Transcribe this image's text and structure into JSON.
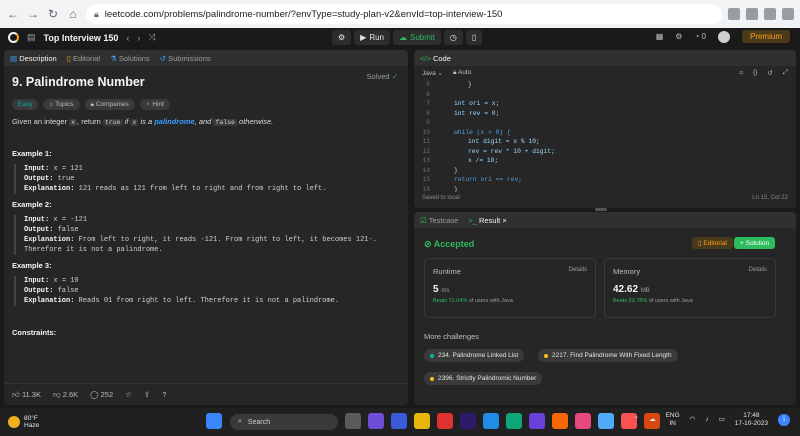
{
  "browser": {
    "url": "leetcode.com/problems/palindrome-number/?envType=study-plan-v2&envId=top-interview-150",
    "back_icon": "arrow-left-icon",
    "forward_icon": "arrow-right-icon",
    "reload_icon": "reload-icon",
    "home_icon": "home-icon"
  },
  "topbar": {
    "title": "Top Interview 150",
    "run_label": "Run",
    "submit_label": "Submit",
    "premium_label": "Premium",
    "streak": "0"
  },
  "description": {
    "tabs": [
      "Description",
      "Editorial",
      "Solutions",
      "Submissions"
    ],
    "problem_title": "9. Palindrome Number",
    "solved_label": "Solved",
    "chips": [
      "Easy",
      "Topics",
      "Companies",
      "Hint"
    ],
    "statement_prefix": "Given an integer",
    "statement_var": "x",
    "statement_mid": ", return",
    "statement_true": "true",
    "statement_if": "if",
    "statement_is": "is a",
    "statement_pal": "palindrome",
    "statement_and": ", and",
    "statement_false": "false",
    "statement_end": "otherwise.",
    "examples": [
      {
        "title": "Example 1:",
        "input": "x = 121",
        "output": "true",
        "explanation": "121 reads as 121 from left to right and from right to left."
      },
      {
        "title": "Example 2:",
        "input": "x = -121",
        "output": "false",
        "explanation": "From left to right, it reads -121. From right to left, it becomes 121-. Therefore it is not a palindrome."
      },
      {
        "title": "Example 3:",
        "input": "x = 10",
        "output": "false",
        "explanation": "Reads 01 from right to left. Therefore it is not a palindrome."
      }
    ],
    "constraints_label": "Constraints:",
    "input_label": "Input:",
    "output_label": "Output:",
    "explanation_label": "Explanation:",
    "footer": {
      "likes": "11.3K",
      "dislikes": "2.6K",
      "comments": "252"
    }
  },
  "code": {
    "tab_label": "Code",
    "language": "Java",
    "mode": "Auto",
    "saved": "Saved to local",
    "cursor": "Ln 15, Col 22",
    "lines": [
      {
        "n": "5",
        "t": "}"
      },
      {
        "n": "6",
        "t": ""
      },
      {
        "n": "7",
        "t": "int ori = x;"
      },
      {
        "n": "8",
        "t": "int rev = 0;"
      },
      {
        "n": "9",
        "t": ""
      },
      {
        "n": "10",
        "t": "while (x > 0) {"
      },
      {
        "n": "11",
        "t": "int digit = x % 10;"
      },
      {
        "n": "12",
        "t": "rev = rev * 10 + digit;"
      },
      {
        "n": "13",
        "t": "x /= 10;"
      },
      {
        "n": "14",
        "t": "}"
      },
      {
        "n": "15",
        "t": "return ori == rev;"
      },
      {
        "n": "16",
        "t": "}"
      }
    ]
  },
  "result": {
    "tabs": [
      "Testcase",
      "Result"
    ],
    "status": "Accepted",
    "editorial_label": "Editorial",
    "solution_label": "Solution",
    "runtime": {
      "title": "Runtime",
      "details": "Details",
      "value": "5",
      "unit": "ms",
      "beats_pct": "Beats 72.04%",
      "beats_rest": "of users with Java"
    },
    "memory": {
      "title": "Memory",
      "details": "Details",
      "value": "42.62",
      "unit": "MB",
      "beats_pct": "Beats 63.78%",
      "beats_rest": "of users with Java"
    },
    "more_label": "More challenges",
    "challenges": [
      {
        "label": "234. Palindrome Linked List",
        "color": "#00b8a3"
      },
      {
        "label": "2217. Find Palindrome With Fixed Length",
        "color": "#ffc01e"
      },
      {
        "label": "2396. Strictly Palindromic Number",
        "color": "#ffc01e"
      }
    ]
  },
  "taskbar": {
    "temp": "80°F",
    "weather": "Haze",
    "search": "Search",
    "lang1": "ENG",
    "lang2": "IN",
    "time": "17:48",
    "date": "17-10-2023",
    "badge": "1"
  }
}
